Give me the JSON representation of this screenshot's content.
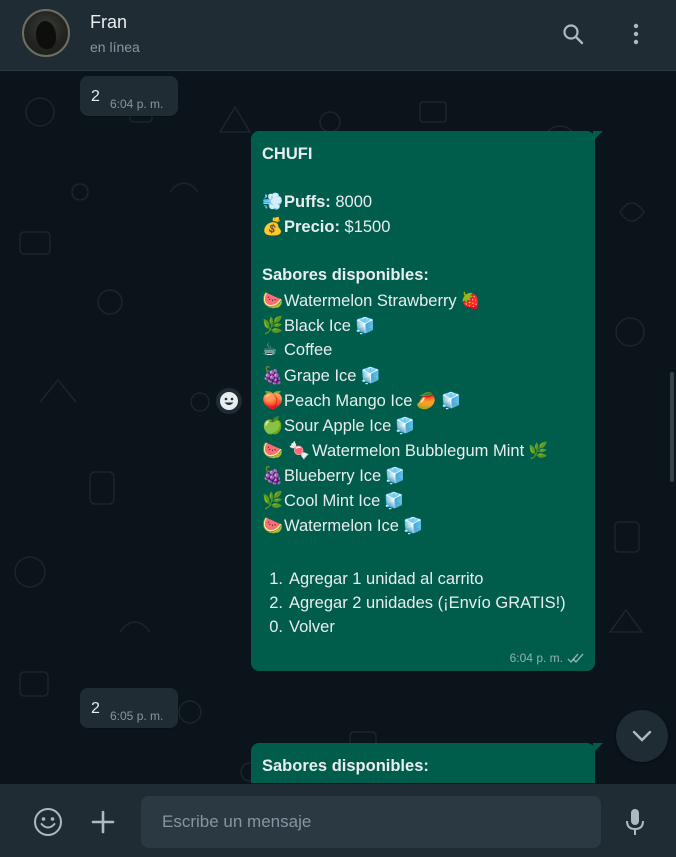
{
  "header": {
    "contact_name": "Fran",
    "contact_status": "en línea"
  },
  "messages": {
    "incoming_1": {
      "text": "2",
      "time": "6:04 p. m."
    },
    "outgoing_1": {
      "title": "CHUFI",
      "puffs_label": "Puffs:",
      "puffs_value": "8000",
      "price_label": "Precio:",
      "price_value": "$1500",
      "flavors_heading": "Sabores disponibles:",
      "flavors": [
        {
          "emoji": "🍉",
          "name": "Watermelon Strawberry",
          "end_emoji": "🍓"
        },
        {
          "emoji": "🌿",
          "name": "Black Ice",
          "end_emoji": "🧊"
        },
        {
          "emoji": "☕",
          "name": "Coffee",
          "end_emoji": ""
        },
        {
          "emoji": "🍇",
          "name": "Grape Ice",
          "end_emoji": "🧊"
        },
        {
          "emoji": "🍑",
          "name": "Peach Mango Ice",
          "end_emoji": "🥭 🧊"
        },
        {
          "emoji": "🍏",
          "name": "Sour Apple Ice",
          "end_emoji": "🧊"
        },
        {
          "emoji": "🍉 🍬",
          "name": "Watermelon Bubblegum Mint",
          "end_emoji": "🌿"
        },
        {
          "emoji": "🍇",
          "name": "Blueberry Ice",
          "end_emoji": "🧊"
        },
        {
          "emoji": "🌿",
          "name": "Cool Mint Ice",
          "end_emoji": "🧊"
        },
        {
          "emoji": "🍉",
          "name": "Watermelon Ice",
          "end_emoji": "🧊"
        }
      ],
      "options": [
        {
          "num": "1.",
          "text": "Agregar 1 unidad al carrito"
        },
        {
          "num": "2.",
          "text": "Agregar 2 unidades (¡Envío GRATIS!)"
        },
        {
          "num": "0.",
          "text": "Volver"
        }
      ],
      "time": "6:04 p. m."
    },
    "incoming_2": {
      "text": "2",
      "time": "6:05 p. m."
    },
    "outgoing_2": {
      "heading": "Sabores disponibles:"
    }
  },
  "footer": {
    "input_placeholder": "Escribe un mensaje",
    "input_value": ""
  },
  "icons": {
    "search": "search-icon",
    "menu": "menu-icon",
    "emoji": "emoji-icon",
    "attach": "plus-icon",
    "mic": "mic-icon",
    "react": "emoji-react-icon",
    "scroll_down": "chevron-down-icon",
    "read_receipt": "double-check-icon"
  },
  "colors": {
    "header_bg": "#202c33",
    "chat_bg": "#0b141a",
    "outgoing_bubble": "#005c4b",
    "incoming_bubble": "#202c33",
    "secondary_text": "#8696a0"
  }
}
